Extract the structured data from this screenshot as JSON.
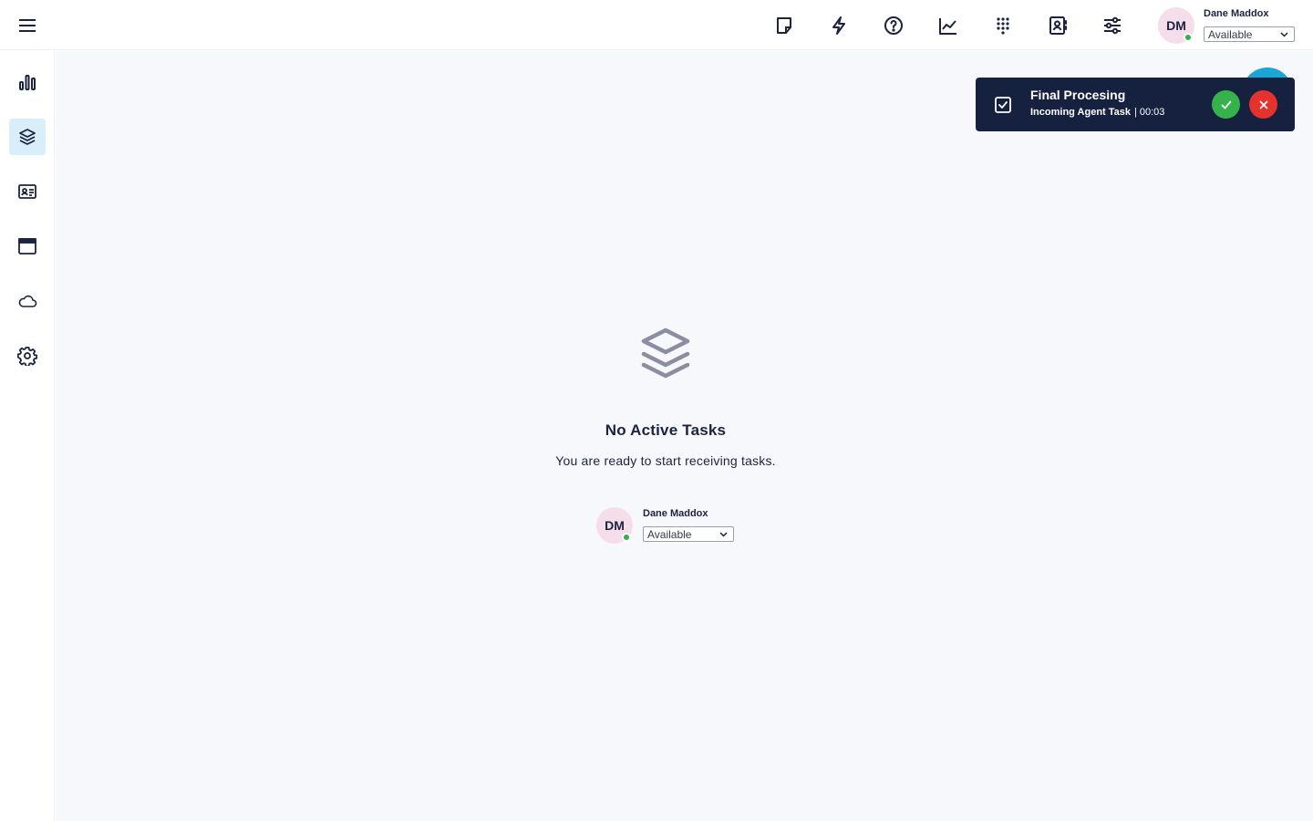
{
  "header": {
    "user": {
      "initials": "DM",
      "name": "Dane Maddox",
      "status": "Available"
    },
    "icons": [
      "sticky-note-icon",
      "bolt-icon",
      "help-icon",
      "analytics-icon",
      "dialpad-icon",
      "contacts-icon",
      "settings-sliders-icon"
    ]
  },
  "sidebar": {
    "items": [
      {
        "icon": "bar-chart-icon",
        "active": false
      },
      {
        "icon": "layers-icon",
        "active": true
      },
      {
        "icon": "contact-card-icon",
        "active": false
      },
      {
        "icon": "browser-window-icon",
        "active": false
      },
      {
        "icon": "cloud-icon",
        "active": false
      },
      {
        "icon": "gear-icon",
        "active": false
      }
    ]
  },
  "main": {
    "empty_state": {
      "title": "No Active Tasks",
      "subtitle": "You are ready to start receiving tasks.",
      "user": {
        "initials": "DM",
        "name": "Dane Maddox",
        "status": "Available"
      }
    }
  },
  "toast": {
    "title": "Final Procesing",
    "task_label": "Incoming Agent Task",
    "separator": "|",
    "timer": "00:03"
  },
  "colors": {
    "accent": "#1aa6d6",
    "toast_bg": "#15213f",
    "accept": "#35b24a",
    "reject": "#e5322d",
    "status_online": "#2fb24a",
    "active_nav_bg": "#d8eefb"
  }
}
